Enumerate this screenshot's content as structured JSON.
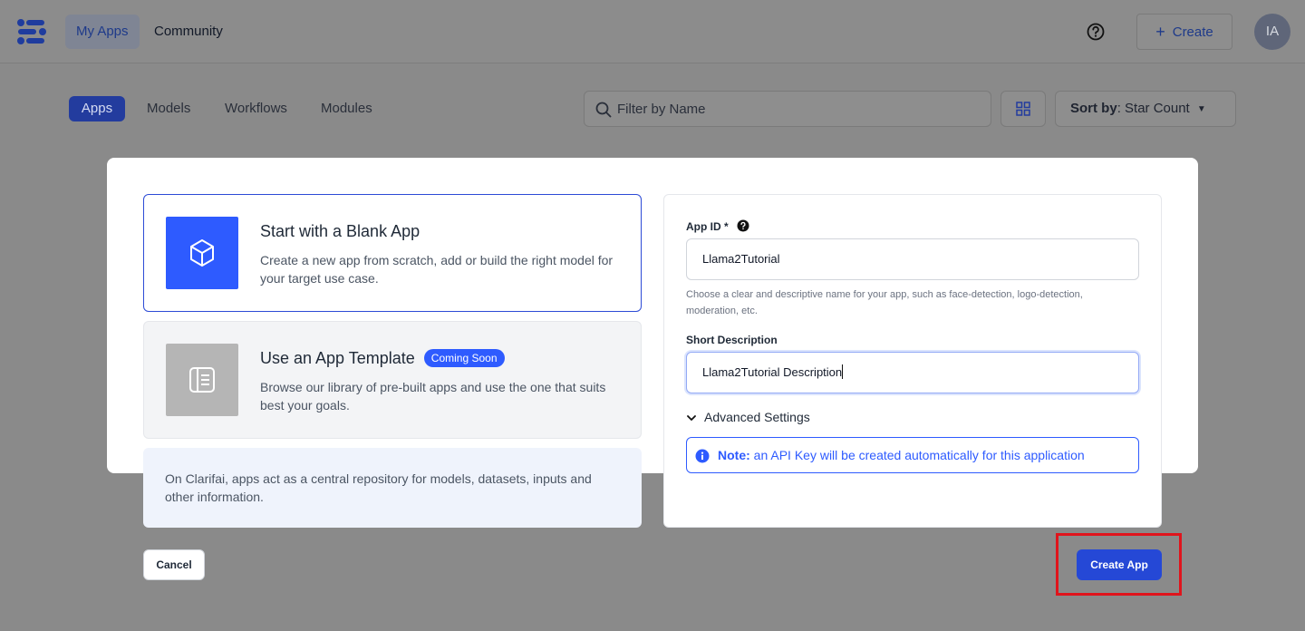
{
  "topnav": {
    "tabs": [
      "My Apps",
      "Community"
    ],
    "create_label": "Create",
    "avatar_initials": "IA"
  },
  "filterbar": {
    "tabs": [
      "Apps",
      "Models",
      "Workflows",
      "Modules"
    ],
    "search_placeholder": "Filter by Name",
    "sort_label": "Sort by",
    "sort_value": ": Star Count"
  },
  "modal": {
    "blank_card": {
      "title": "Start with a Blank App",
      "description": "Create a new app from scratch, add or build the right model for your target use case."
    },
    "template_card": {
      "title": "Use an App Template",
      "badge": "Coming Soon",
      "description": "Browse our library of pre-built apps and use the one that suits best your goals."
    },
    "info_text": "On Clarifai, apps act as a central repository for models, datasets, inputs and other information.",
    "form": {
      "app_id_label": "App ID *",
      "app_id_value": "Llama2Tutorial",
      "app_id_helper": "Choose a clear and descriptive name for your app, such as face-detection, logo-detection, moderation, etc.",
      "short_desc_label": "Short Description",
      "short_desc_value": "Llama2Tutorial Description",
      "advanced_label": "Advanced Settings",
      "note_label": "Note:",
      "note_text": " an API Key will be created automatically for this application"
    },
    "cancel_label": "Cancel",
    "create_app_label": "Create App"
  },
  "colors": {
    "accent": "#2e5bff",
    "primary_button": "#2548d6",
    "highlight_box": "#e0141c",
    "overlay": "#8a8a8a"
  },
  "icons": [
    "clarifai-logo",
    "help-circle-icon",
    "plus-icon",
    "search-icon",
    "grid-view-icon",
    "caret-down-icon",
    "cube-icon",
    "template-icon",
    "question-icon",
    "chevron-down-icon",
    "info-icon"
  ]
}
